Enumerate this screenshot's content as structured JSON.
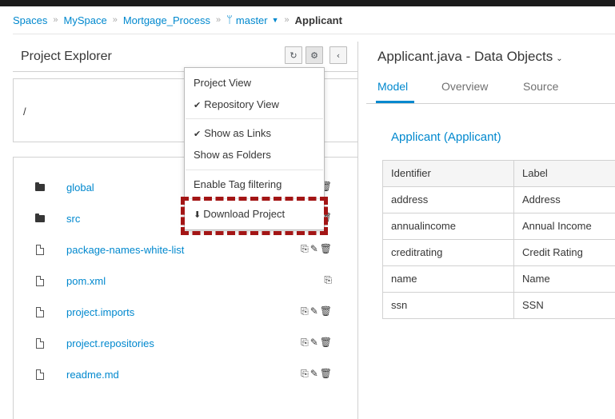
{
  "breadcrumb": {
    "items": [
      "Spaces",
      "MySpace",
      "Mortgage_Process"
    ],
    "branch": "master",
    "current": "Applicant"
  },
  "explorer": {
    "title": "Project Explorer",
    "path": "/",
    "files": [
      {
        "name": "global",
        "type": "folder"
      },
      {
        "name": "src",
        "type": "folder"
      },
      {
        "name": "package-names-white-list",
        "type": "file"
      },
      {
        "name": "pom.xml",
        "type": "file"
      },
      {
        "name": "project.imports",
        "type": "file"
      },
      {
        "name": "project.repositories",
        "type": "file"
      },
      {
        "name": "readme.md",
        "type": "file"
      }
    ]
  },
  "menu": {
    "project_view": "Project View",
    "repository_view": "Repository View",
    "show_as_links": "Show as Links",
    "show_as_folders": "Show as Folders",
    "enable_tag_filtering": "Enable Tag filtering",
    "download_project": "Download Project"
  },
  "editor": {
    "title": "Applicant.java - Data Objects",
    "tabs": [
      "Model",
      "Overview",
      "Source"
    ],
    "active_tab": "Model",
    "object_title": "Applicant (Applicant)",
    "columns": [
      "Identifier",
      "Label"
    ],
    "rows": [
      [
        "address",
        "Address"
      ],
      [
        "annualincome",
        "Annual Income"
      ],
      [
        "creditrating",
        "Credit Rating"
      ],
      [
        "name",
        "Name"
      ],
      [
        "ssn",
        "SSN"
      ]
    ]
  },
  "colors": {
    "accent": "#0088ce",
    "highlight": "#a31515"
  }
}
